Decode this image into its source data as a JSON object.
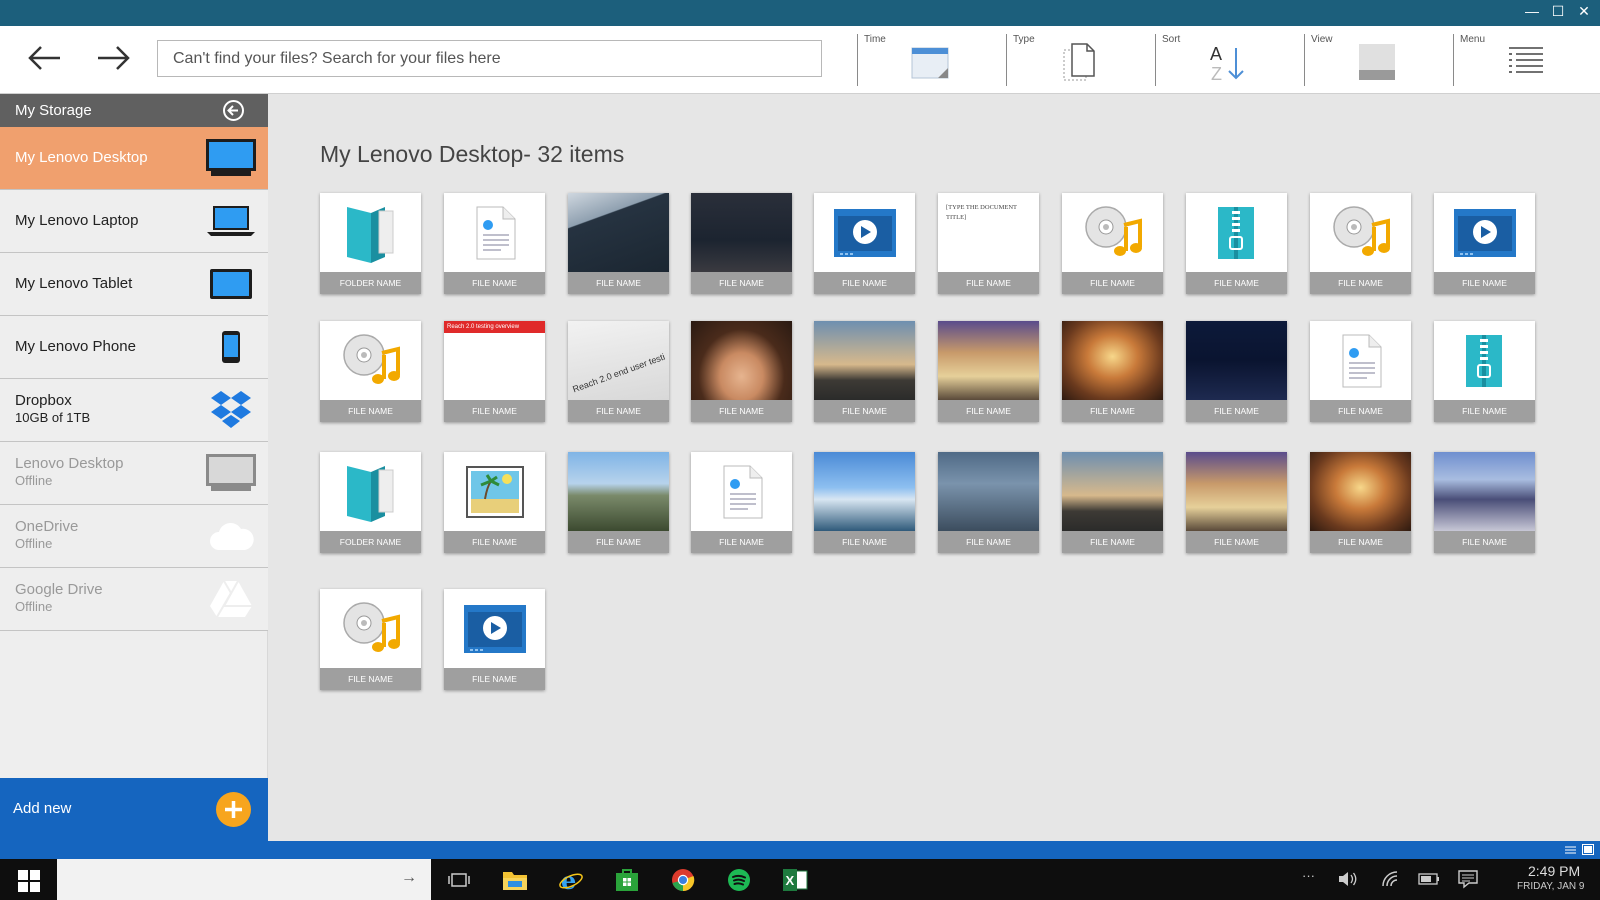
{
  "window": {
    "minimize": "—",
    "maximize": "☐",
    "close": "✕"
  },
  "toolbar": {
    "search_placeholder": "Can't find your files? Search for your files here",
    "tools": [
      {
        "label": "Time",
        "icon": "calendar-icon"
      },
      {
        "label": "Type",
        "icon": "document-type-icon"
      },
      {
        "label": "Sort",
        "icon": "sort-az-icon"
      },
      {
        "label": "View",
        "icon": "view-icon"
      },
      {
        "label": "Menu",
        "icon": "menu-list-icon"
      }
    ]
  },
  "sidebar": {
    "header": "My Storage",
    "items": [
      {
        "label": "My Lenovo Desktop",
        "sub": "",
        "icon": "desktop-monitor-icon",
        "active": true
      },
      {
        "label": "My Lenovo Laptop",
        "sub": "",
        "icon": "laptop-icon"
      },
      {
        "label": "My Lenovo Tablet",
        "sub": "",
        "icon": "tablet-icon"
      },
      {
        "label": "My Lenovo Phone",
        "sub": "",
        "icon": "phone-icon"
      },
      {
        "label": "Dropbox",
        "sub": "10GB of 1TB",
        "icon": "dropbox-icon"
      },
      {
        "label": "Lenovo Desktop",
        "sub": "Offline",
        "icon": "desktop-monitor-icon"
      },
      {
        "label": "OneDrive",
        "sub": "Offline",
        "icon": "cloud-icon"
      },
      {
        "label": "Google Drive",
        "sub": "Offline",
        "icon": "google-drive-icon"
      }
    ],
    "add_new": "Add new"
  },
  "main": {
    "title": "My Lenovo Desktop- 32 items",
    "tiles": [
      {
        "name": "FOLDER NAME",
        "kind": "folder"
      },
      {
        "name": "FILE NAME",
        "kind": "document"
      },
      {
        "name": "FILE NAME",
        "kind": "photo-tablet"
      },
      {
        "name": "FILE NAME",
        "kind": "photo-monitor"
      },
      {
        "name": "FILE NAME",
        "kind": "video"
      },
      {
        "name": "FILE NAME",
        "kind": "text-document",
        "text": "[TYPE THE DOCUMENT TITLE]"
      },
      {
        "name": "FILE NAME",
        "kind": "music"
      },
      {
        "name": "FILE NAME",
        "kind": "zip"
      },
      {
        "name": "FILE NAME",
        "kind": "music"
      },
      {
        "name": "FILE NAME",
        "kind": "video"
      },
      {
        "name": "FILE NAME",
        "kind": "music"
      },
      {
        "name": "FILE NAME",
        "kind": "slide",
        "text": "Reach 2.0 testing overview"
      },
      {
        "name": "FILE NAME",
        "kind": "photo-paper",
        "text": "Reach 2.0 end user testi"
      },
      {
        "name": "FILE NAME",
        "kind": "photo-child"
      },
      {
        "name": "FILE NAME",
        "kind": "photo-sunset"
      },
      {
        "name": "FILE NAME",
        "kind": "photo-building"
      },
      {
        "name": "FILE NAME",
        "kind": "photo-arch"
      },
      {
        "name": "FILE NAME",
        "kind": "photo-speaker"
      },
      {
        "name": "FILE NAME",
        "kind": "document"
      },
      {
        "name": "FILE NAME",
        "kind": "zip"
      },
      {
        "name": "FOLDER NAME",
        "kind": "folder"
      },
      {
        "name": "FILE NAME",
        "kind": "image"
      },
      {
        "name": "FILE NAME",
        "kind": "photo-mountain"
      },
      {
        "name": "FILE NAME",
        "kind": "document"
      },
      {
        "name": "FILE NAME",
        "kind": "photo-harbor"
      },
      {
        "name": "FILE NAME",
        "kind": "photo-city"
      },
      {
        "name": "FILE NAME",
        "kind": "photo-sunset"
      },
      {
        "name": "FILE NAME",
        "kind": "photo-building"
      },
      {
        "name": "FILE NAME",
        "kind": "photo-arch"
      },
      {
        "name": "FILE NAME",
        "kind": "photo-mansion"
      },
      {
        "name": "FILE NAME",
        "kind": "music"
      },
      {
        "name": "FILE NAME",
        "kind": "video"
      }
    ]
  },
  "taskbar": {
    "search_arrow": "→",
    "apps": [
      "task-view-icon",
      "file-explorer-icon",
      "internet-explorer-icon",
      "store-icon",
      "chrome-icon",
      "spotify-icon",
      "excel-icon"
    ],
    "tray_more": "···",
    "time": "2:49 PM",
    "date": "FRIDAY, JAN 9"
  }
}
